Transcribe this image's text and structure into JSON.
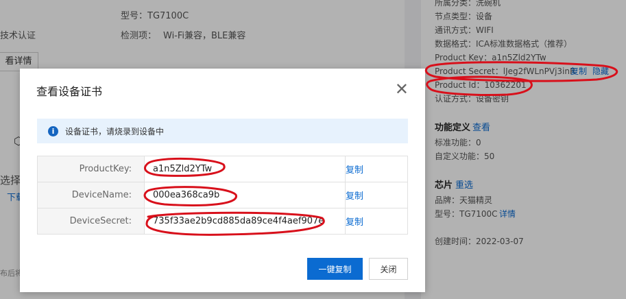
{
  "background": {
    "model_line": "型号：TG7100C",
    "cert_text": "技术认证",
    "detect_text": "检测项：",
    "detect_value": "Wi-Fi兼容，BLE兼容",
    "view_details_btn": "看详情",
    "select_text": "选择",
    "download_text": "下载",
    "bottom_text": "布后将"
  },
  "right_panel": {
    "category": "所属分类：洗碗机",
    "node_type": "节点类型：设备",
    "comm": "通讯方式：WIFI",
    "data_format": "数据格式：ICA标准数据格式（推荐）",
    "product_key": "Product Key：a1n5Zld2YTw",
    "product_secret": "Product Secret：lJeg2fWLnPVj3inR",
    "copy": "复制",
    "hide": "隐藏",
    "product_id": "Product Id：10362201",
    "auth": "认证方式：设备密钥",
    "func_title": "功能定义",
    "func_view": "查看",
    "std_func": "标准功能：0",
    "custom_func": "自定义功能：50",
    "chip_title": "芯片",
    "chip_reselect": "重选",
    "brand": "品牌：天猫精灵",
    "chip_model": "型号：TG7100C",
    "chip_detail": "详情",
    "created": "创建时间：2022-03-07"
  },
  "modal": {
    "title": "查看设备证书",
    "info": "设备证书，请烧录到设备中",
    "rows": [
      {
        "key": "ProductKey:",
        "value": "a1n5Zld2YTw",
        "action": "复制"
      },
      {
        "key": "DeviceName:",
        "value": "000ea368ca9b",
        "action": "复制"
      },
      {
        "key": "DeviceSecret:",
        "value": "735f33ae2b9cd885da89ce4f4aef907e",
        "action": "复制"
      }
    ],
    "copy_all": "一键复制",
    "close": "关闭"
  },
  "colors": {
    "accent": "#0b6bd1",
    "annotation": "#d8101b"
  }
}
